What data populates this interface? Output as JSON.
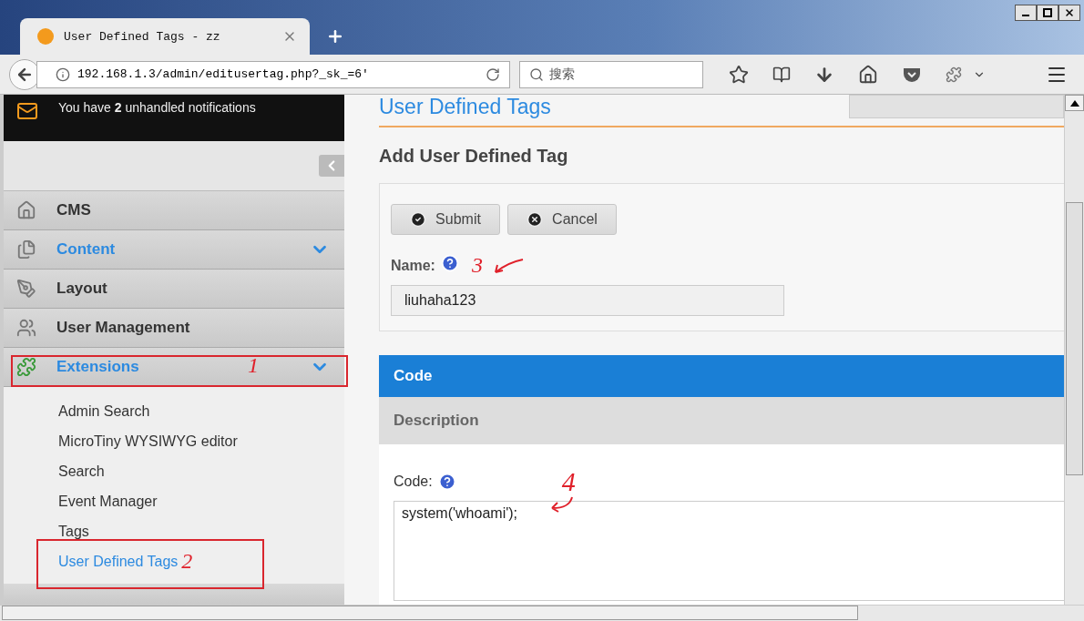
{
  "browser": {
    "tab_title": "User Defined Tags - zz",
    "url": "192.168.1.3/admin/editusertag.php?_sk_=6'",
    "search_placeholder": "搜索"
  },
  "notification": {
    "text": "You have **2** unhandled notifications"
  },
  "sidebar": {
    "items": [
      {
        "label": "CMS",
        "has_children": false
      },
      {
        "label": "Content",
        "has_children": true
      },
      {
        "label": "Layout",
        "has_children": false
      },
      {
        "label": "User Management",
        "has_children": false
      },
      {
        "label": "Extensions",
        "has_children": true,
        "annotation": "1",
        "children": [
          {
            "label": "Admin Search",
            "selected": false
          },
          {
            "label": "MicroTiny WYSIWYG editor",
            "selected": false
          },
          {
            "label": "Search",
            "selected": false
          },
          {
            "label": "Event Manager",
            "selected": false
          },
          {
            "label": "Tags",
            "selected": false
          },
          {
            "label": "User Defined Tags",
            "selected": true,
            "annotation": "2"
          }
        ]
      }
    ]
  },
  "main": {
    "page_title": "User Defined Tags",
    "form_title": "Add User Defined Tag",
    "buttons": [
      {
        "label": "Submit"
      },
      {
        "label": "Cancel"
      }
    ],
    "name_field": {
      "label": "Name:",
      "value": "liuhaha123",
      "annotation": "3"
    },
    "tabs": [
      {
        "label": "Code",
        "selected": true
      },
      {
        "label": "Description",
        "selected": false
      }
    ],
    "code_field": {
      "label": "Code:",
      "value": "system('whoami');",
      "annotation": "4"
    }
  }
}
